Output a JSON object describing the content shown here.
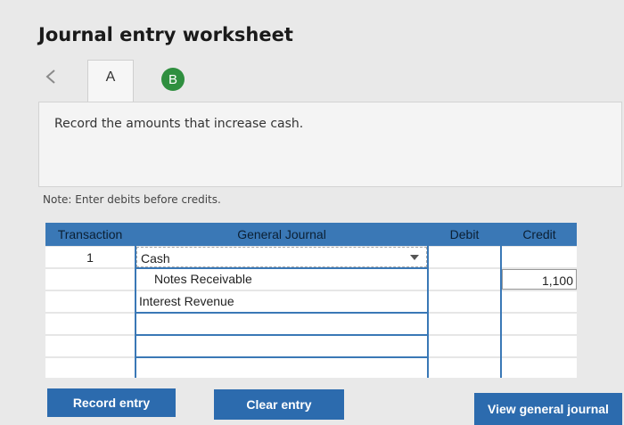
{
  "page": {
    "title": "Journal entry worksheet",
    "note": "Note: Enter debits before credits."
  },
  "nav": {
    "back_icon": "chevron-left-icon",
    "tabs": [
      {
        "label": "A",
        "state": "inactive"
      },
      {
        "label": "B",
        "state": "active",
        "color": "#2f8f3f"
      }
    ]
  },
  "instruction": "Record the amounts that increase cash.",
  "journal": {
    "headers": {
      "transaction": "Transaction",
      "general_journal": "General Journal",
      "debit": "Debit",
      "credit": "Credit"
    },
    "rows": [
      {
        "transaction": "1",
        "account": "Cash",
        "debit": "",
        "credit": ""
      },
      {
        "transaction": "",
        "account": "Notes Receivable",
        "debit": "",
        "credit": "1,100"
      },
      {
        "transaction": "",
        "account": "Interest Revenue",
        "debit": "",
        "credit": ""
      },
      {
        "transaction": "",
        "account": "",
        "debit": "",
        "credit": ""
      },
      {
        "transaction": "",
        "account": "",
        "debit": "",
        "credit": ""
      },
      {
        "transaction": "",
        "account": "",
        "debit": "",
        "credit": ""
      }
    ]
  },
  "buttons": {
    "record": "Record entry",
    "clear": "Clear entry",
    "view": "View general journal"
  },
  "colors": {
    "accent": "#2c6bae",
    "header": "#3a78b6",
    "tab_active": "#2f8f3f"
  }
}
